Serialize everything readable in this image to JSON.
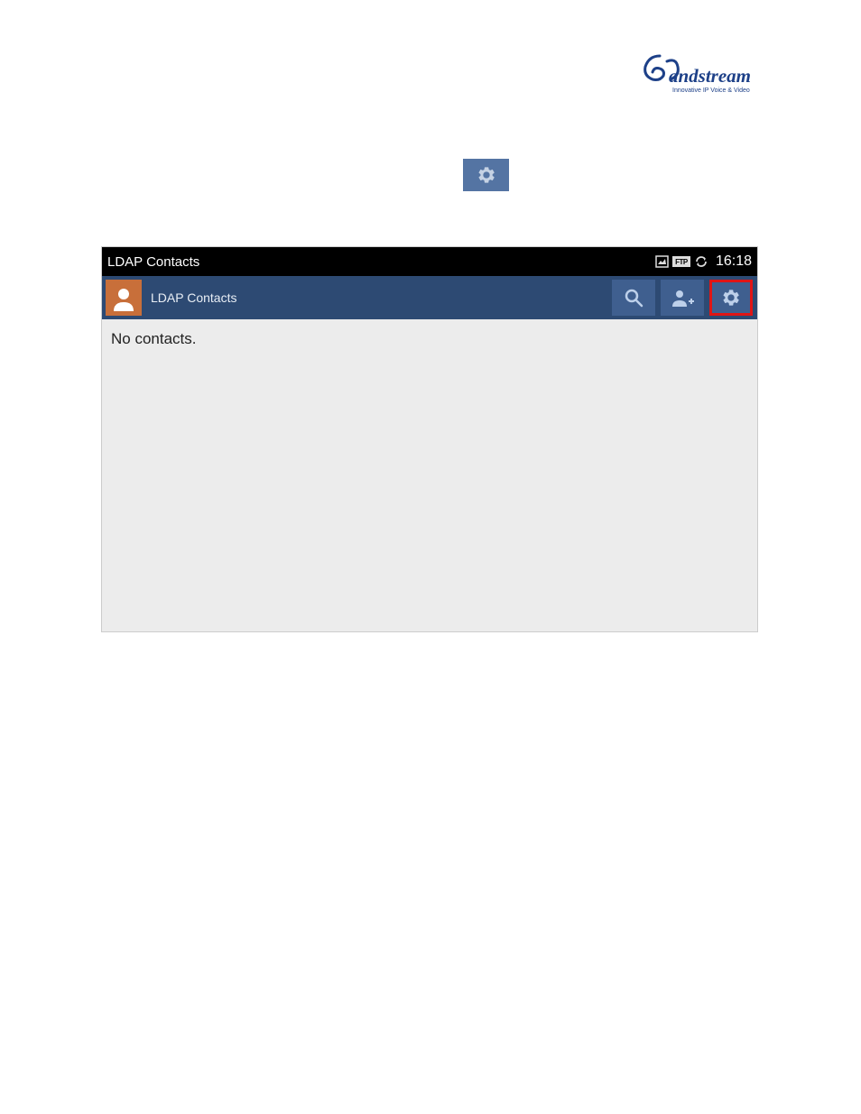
{
  "logo": {
    "brand": "andstream",
    "tagline": "Innovative IP Voice & Video"
  },
  "inline_gear": {
    "label": "settings"
  },
  "screenshot": {
    "status_bar": {
      "title": "LDAP Contacts",
      "ftp_label": "FTP",
      "time": "16:18"
    },
    "toolbar": {
      "title": "LDAP Contacts"
    },
    "content": {
      "empty_message": "No contacts."
    }
  }
}
